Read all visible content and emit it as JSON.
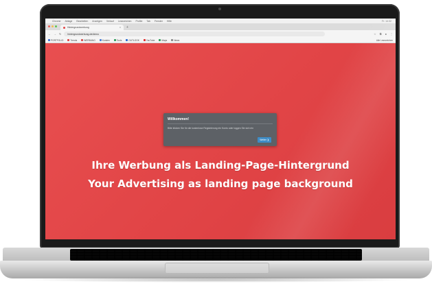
{
  "menubar": {
    "items": [
      "Chrome",
      "Ablage",
      "Bearbeiten",
      "Anzeigen",
      "Verlauf",
      "Lesezeichen",
      "Profile",
      "Tab",
      "Fenster",
      "Hilfe"
    ],
    "clock": "Fr. 14:32"
  },
  "browser": {
    "tab_title": "Hintergrundwerbung",
    "tab_close": "×",
    "new_tab": "+",
    "url": "hintergrundwerbung.de/demo",
    "nav": {
      "back": "←",
      "forward": "→",
      "reload": "↻"
    }
  },
  "bookmarks": [
    {
      "label": "PORTFOLIO",
      "color": "#3b6fd6"
    },
    {
      "label": "Trends",
      "color": "#e14646"
    },
    {
      "label": "WERBUNG",
      "color": "#d74a4a"
    },
    {
      "label": "Kunden",
      "color": "#4a7fd6"
    },
    {
      "label": "Tools",
      "color": "#2f9e5a"
    },
    {
      "label": "OUTLOOK",
      "color": "#2a6bd0"
    },
    {
      "label": "YouTube",
      "color": "#e02b2b"
    },
    {
      "label": "Maps",
      "color": "#2f9e5a"
    },
    {
      "label": "News",
      "color": "#888888"
    }
  ],
  "bookmarks_right": "Alle Lesezeichen",
  "dialog": {
    "title": "Willkommen!",
    "text": "Bitte klicken Sie für die kostenlose Registrierung ein Konto oder loggen Sie sich ein",
    "button": "Weiter ❯"
  },
  "headline": {
    "line1": "Ihre Werbung als Landing-Page-Hintergrund",
    "line2": "Your Advertising as landing page background"
  },
  "colors": {
    "page_background": "#e14446",
    "dialog_background": "#5d6166",
    "dialog_button": "#3e8cc6"
  }
}
